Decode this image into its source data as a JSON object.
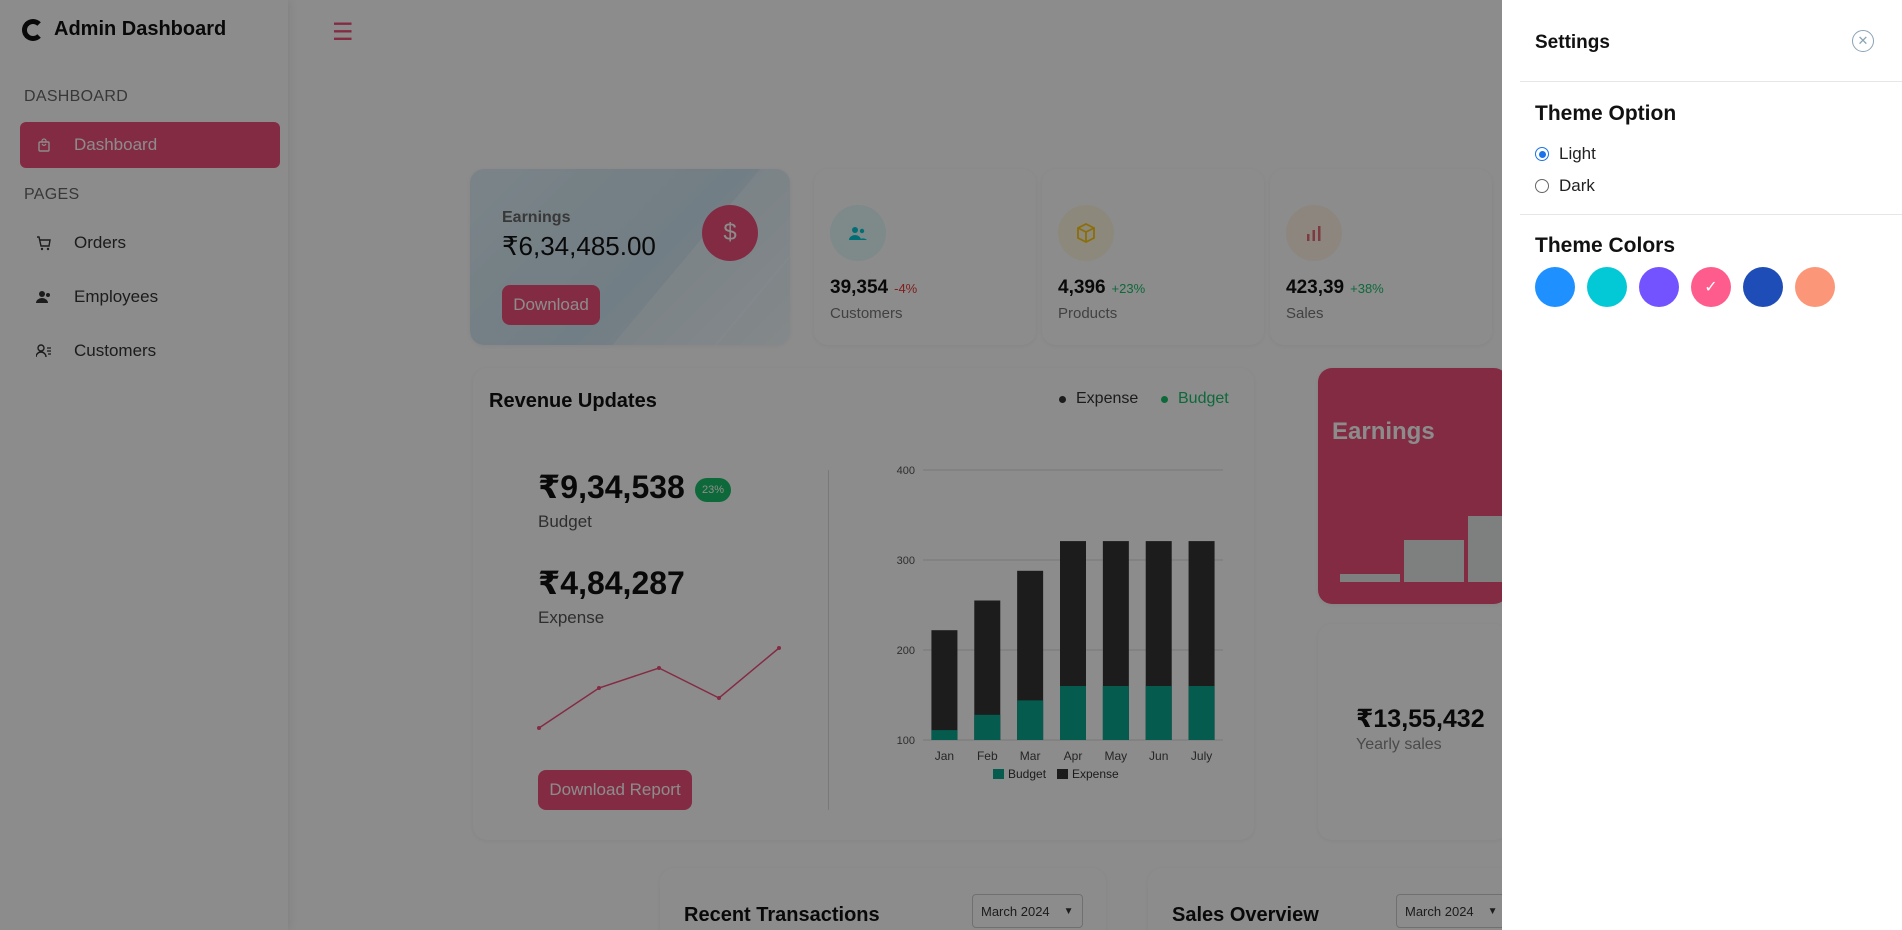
{
  "brand": {
    "title": "Admin Dashboard"
  },
  "sidebar": {
    "section_dashboard": "DASHBOARD",
    "section_pages": "PAGES",
    "items": [
      {
        "label": "Dashboard",
        "icon": "shopping-bag-icon",
        "active": true
      },
      {
        "label": "Orders",
        "icon": "cart-icon"
      },
      {
        "label": "Employees",
        "icon": "users-icon"
      },
      {
        "label": "Customers",
        "icon": "user-list-icon"
      }
    ]
  },
  "earnings_card": {
    "label": "Earnings",
    "value": "₹6,34,485.00",
    "button": "Download"
  },
  "stats": [
    {
      "value": "39,354",
      "pct": "-4%",
      "name": "Customers",
      "pct_color": "#e53935",
      "icon": "users-icon"
    },
    {
      "value": "4,396",
      "pct": "+23%",
      "name": "Products",
      "pct_color": "#1bbf6a",
      "icon": "box-icon"
    },
    {
      "value": "423,39",
      "pct": "+38%",
      "name": "Sales",
      "pct_color": "#1bbf6a",
      "icon": "bar-chart-icon"
    }
  ],
  "revenue": {
    "title": "Revenue Updates",
    "legend_expense": "Expense",
    "legend_budget": "Budget",
    "budget_value": "₹9,34,538",
    "budget_pct": "23%",
    "budget_label": "Budget",
    "expense_value": "₹4,84,287",
    "expense_label": "Expense",
    "button": "Download Report"
  },
  "chart_data": [
    {
      "type": "bar",
      "stacked": true,
      "categories": [
        "Jan",
        "Feb",
        "Mar",
        "Apr",
        "May",
        "Jun",
        "July"
      ],
      "series": [
        {
          "name": "Budget",
          "values": [
            111,
            128,
            144,
            160,
            160,
            160,
            160
          ],
          "color": "#0aa78f"
        },
        {
          "name": "Expense",
          "values": [
            222,
            255,
            288,
            321,
            321,
            321,
            321
          ],
          "color": "#333333"
        }
      ],
      "ylim": [
        100,
        400
      ],
      "yticks": [
        100,
        200,
        300,
        400
      ],
      "legend": "bottom"
    },
    {
      "type": "line",
      "x": [
        1,
        2,
        3,
        4,
        5
      ],
      "values": [
        2,
        6,
        8,
        5,
        10
      ],
      "color": "#f04f7d"
    }
  ],
  "earnings_side": {
    "title": "Earnings",
    "yearly_value": "₹13,55,432",
    "yearly_label": "Yearly sales"
  },
  "bottom": {
    "transactions_title": "Recent Transactions",
    "sales_title": "Sales Overview",
    "month": "March 2024"
  },
  "settings": {
    "title": "Settings",
    "theme_option_heading": "Theme Option",
    "light_label": "Light",
    "dark_label": "Dark",
    "selected_mode": "Light",
    "theme_colors_heading": "Theme Colors",
    "colors": [
      "#1E90FF",
      "#03C9D7",
      "#7352FF",
      "#FF5C8E",
      "#1E4DB7",
      "#FB9678"
    ],
    "selected_color": "#FF5C8E"
  }
}
